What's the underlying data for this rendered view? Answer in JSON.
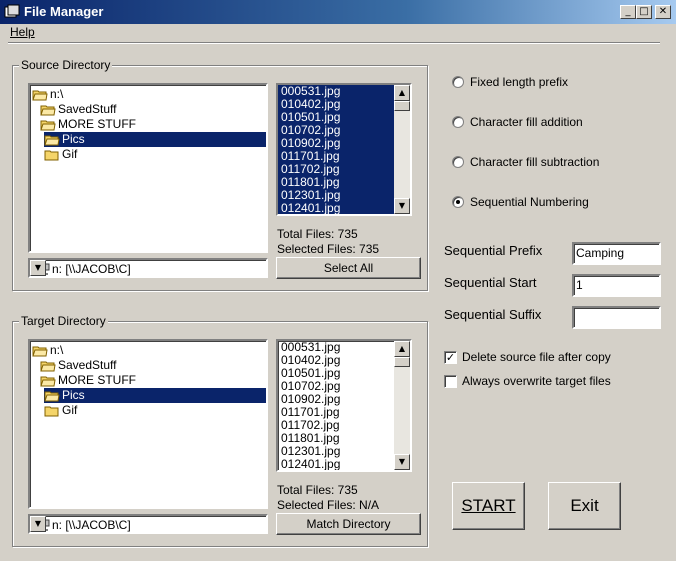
{
  "window": {
    "title": "File Manager",
    "minimize_glyph": "_",
    "maximize_glyph": "□",
    "close_glyph": "✕"
  },
  "menu": {
    "help": "Help"
  },
  "source": {
    "group_label": "Source Directory",
    "tree": [
      {
        "label": "n:\\",
        "selected": false
      },
      {
        "label": "SavedStuff",
        "selected": false
      },
      {
        "label": "MORE STUFF",
        "selected": false
      },
      {
        "label": "Pics",
        "selected": true
      },
      {
        "label": "Gif",
        "selected": false
      }
    ],
    "files": [
      "000531.jpg",
      "010402.jpg",
      "010501.jpg",
      "010702.jpg",
      "010902.jpg",
      "011701.jpg",
      "011702.jpg",
      "011801.jpg",
      "012301.jpg",
      "012401.jpg"
    ],
    "total_files": "Total Files: 735",
    "selected_files": "Selected Files: 735",
    "drive": "n: [\\\\JACOB\\C]",
    "action_button": "Select All"
  },
  "target": {
    "group_label": "Target Directory",
    "tree": [
      {
        "label": "n:\\",
        "selected": false
      },
      {
        "label": "SavedStuff",
        "selected": false
      },
      {
        "label": "MORE STUFF",
        "selected": false
      },
      {
        "label": "Pics",
        "selected": true
      },
      {
        "label": "Gif",
        "selected": false
      }
    ],
    "files": [
      "000531.jpg",
      "010402.jpg",
      "010501.jpg",
      "010702.jpg",
      "010902.jpg",
      "011701.jpg",
      "011702.jpg",
      "011801.jpg",
      "012301.jpg",
      "012401.jpg"
    ],
    "total_files": "Total Files: 735",
    "selected_files": "Selected Files: N/A",
    "drive": "n: [\\\\JACOB\\C]",
    "action_button": "Match Directory"
  },
  "options": {
    "radios": [
      {
        "label": "Fixed length prefix",
        "checked": false
      },
      {
        "label": "Character fill addition",
        "checked": false
      },
      {
        "label": "Character fill subtraction",
        "checked": false
      },
      {
        "label": "Sequential Numbering",
        "checked": true
      }
    ],
    "sequential_prefix_label": "Sequential Prefix",
    "sequential_prefix_value": "Camping",
    "sequential_start_label": "Sequential Start",
    "sequential_start_value": "1",
    "sequential_suffix_label": "Sequential Suffix",
    "sequential_suffix_value": "",
    "checkboxes": [
      {
        "label": "Delete source file after copy",
        "checked": true
      },
      {
        "label": "Always overwrite target files",
        "checked": false
      }
    ],
    "check_glyph": "✓"
  },
  "buttons": {
    "start": "START",
    "exit": "Exit"
  },
  "colors": {
    "titlebar_start": "#0a246a",
    "selection": "#0a246a",
    "face": "#d4d0c8",
    "folder": "#f5d56a"
  }
}
